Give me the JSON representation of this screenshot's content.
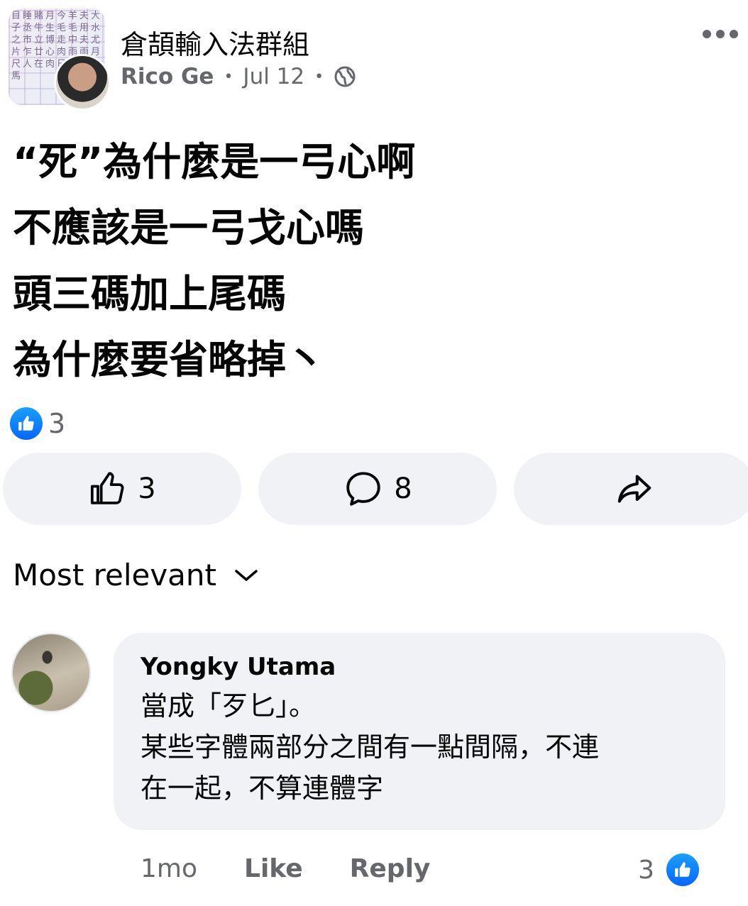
{
  "post": {
    "group_name": "倉頡輸入法群組",
    "author": "Rico Ge",
    "date": "Jul 12",
    "visibility_icon": "globe-icon",
    "text": "“死”為什麼是一弓心啊\n不應該是一弓戈心嗎\n頭三碼加上尾碼\n為什麼要省略掉丶",
    "reaction_count": "3",
    "like_count": "3",
    "comment_count": "8"
  },
  "group_avatar_glyphs": "目睡賭月今羊夫大子丞牛生毛毛用水之市立博走中夫尤片乍廿心肉雨雨月尺人在肉日易昆呂馬",
  "sort": {
    "label": "Most relevant"
  },
  "comment": {
    "author": "Yongky Utama",
    "text": "當成「歹匕」。\n某些字體兩部分之間有一點間隔，不連\n在一起，不算連體字",
    "time": "1mo",
    "like_label": "Like",
    "reply_label": "Reply",
    "reaction_count": "3"
  },
  "colors": {
    "accent": "#0866ff",
    "secondary_text": "#65676b",
    "button_bg": "#f0f2f5"
  }
}
